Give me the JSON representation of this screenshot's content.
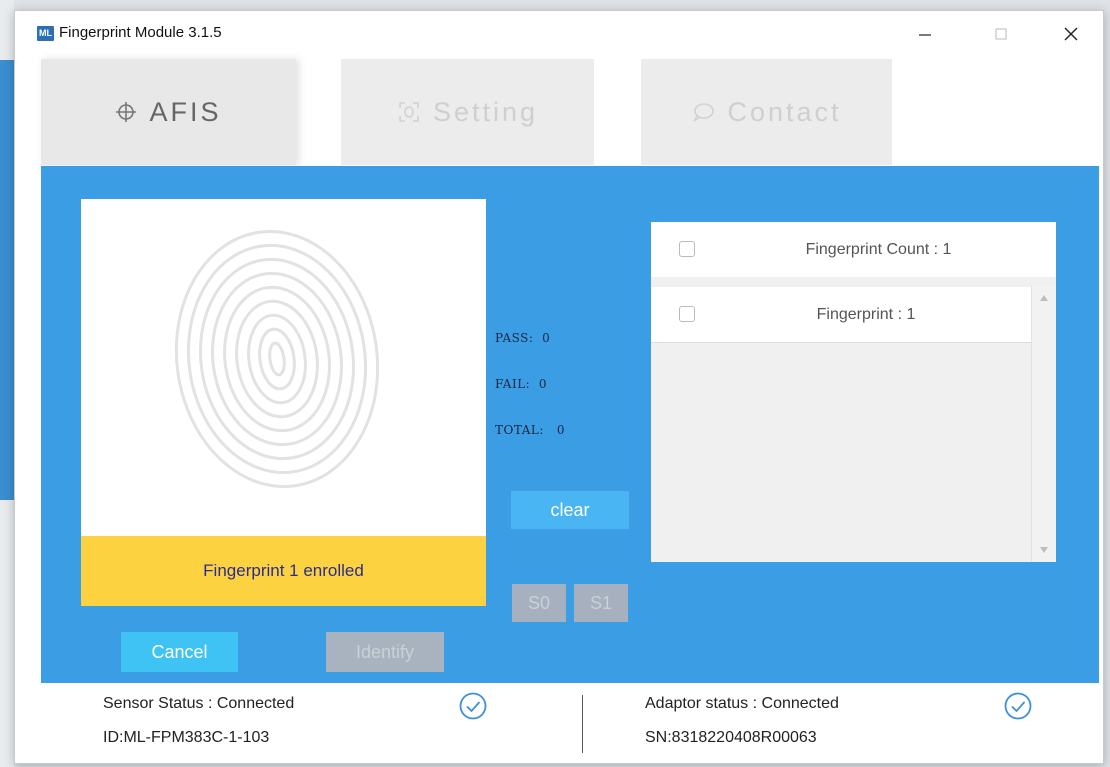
{
  "window": {
    "logo_text": "ML",
    "title": "Fingerprint Module 3.1.5",
    "controls": {
      "minimize": "—",
      "maximize": "□",
      "close": "✕"
    }
  },
  "tabs": [
    {
      "label": "AFIS",
      "icon": "crosshair-icon",
      "active": true
    },
    {
      "label": "Setting",
      "icon": "fingerprint-scan-icon",
      "active": false
    },
    {
      "label": "Contact",
      "icon": "chat-bubble-icon",
      "active": false
    }
  ],
  "enroll": {
    "status": "Fingerprint 1 enrolled",
    "cancel_label": "Cancel",
    "identify_label": "Identify"
  },
  "stats": {
    "pass_label": "PASS:",
    "pass_value": "0",
    "fail_label": "FAIL:",
    "fail_value": "0",
    "total_label": "TOTAL:",
    "total_value": "0",
    "clear_label": "clear",
    "s0_label": "S0",
    "s1_label": "S1"
  },
  "list": {
    "header": "Fingerprint Count : 1",
    "items": [
      {
        "label": "Fingerprint : 1"
      }
    ]
  },
  "footer": {
    "sensor_status": "Sensor Status : Connected",
    "sensor_id": "ID:ML-FPM383C-1-103",
    "adaptor_status": "Adaptor status : Connected",
    "adaptor_sn": "SN:8318220408R00063"
  },
  "colors": {
    "panel": "#3b9ee5",
    "status_bar": "#fdd241",
    "cancel_button": "#3fc3f5",
    "disabled_button": "#a9b3bf",
    "check_icon": "#3b8fe0"
  }
}
